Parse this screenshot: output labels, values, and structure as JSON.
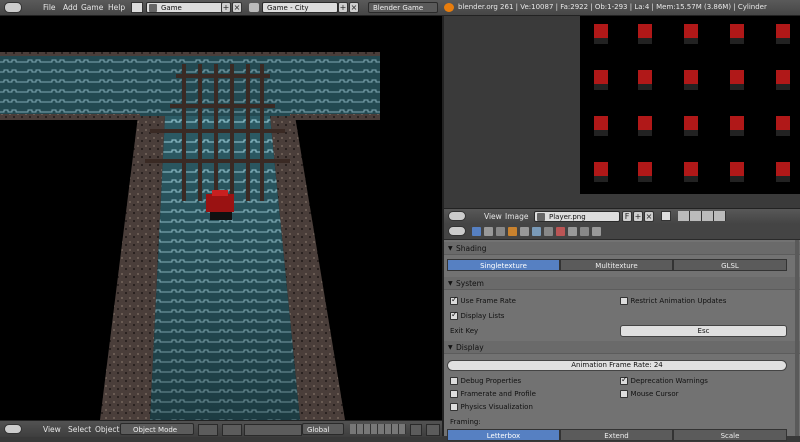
{
  "topbar": {
    "menus": [
      "File",
      "Add",
      "Game",
      "Help"
    ],
    "screen_name": "Game",
    "scene_name": "Game - City",
    "engine": "Blender Game",
    "stats": "blender.org 261 | Ve:10087 | Fa:2922 | Ob:1-293 | La:4 | Mem:15.57M (3.86M) | Cylinder"
  },
  "viewport_header": {
    "menus": [
      "View",
      "Select",
      "Object"
    ],
    "mode": "Object Mode",
    "orientation": "Global"
  },
  "image_editor": {
    "menus": [
      "View",
      "Image"
    ],
    "image_name": "Player.png",
    "fake_user": "F"
  },
  "properties": {
    "shading": {
      "title": "Shading",
      "options": [
        "Singletexture",
        "Multitexture",
        "GLSL"
      ],
      "active": 0
    },
    "system": {
      "title": "System",
      "use_frame_rate": "Use Frame Rate",
      "restrict_animation": "Restrict Animation Updates",
      "display_lists": "Display Lists",
      "exit_key_label": "Exit Key",
      "exit_key_value": "Esc"
    },
    "display": {
      "title": "Display",
      "frame_rate": "Animation Frame Rate: 24",
      "debug_properties": "Debug Properties",
      "deprecation_warnings": "Deprecation Warnings",
      "framerate_profile": "Framerate and Profile",
      "mouse_cursor": "Mouse Cursor",
      "physics_vis": "Physics Visualization",
      "framing_label": "Framing:",
      "framing_options": [
        "Letterbox",
        "Extend",
        "Scale"
      ]
    }
  },
  "colors": {
    "accent": "#5680c2",
    "water": "#2a5560",
    "sprite_red": "#b01818"
  }
}
